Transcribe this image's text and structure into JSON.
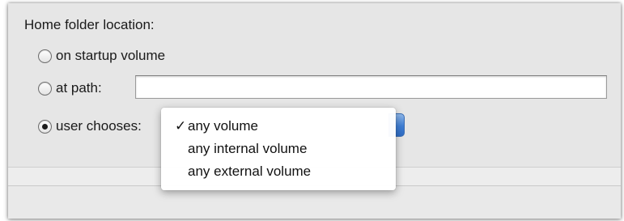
{
  "home_folder": {
    "section_label": "Home folder location:",
    "options": [
      {
        "label": "on startup volume",
        "selected": false
      },
      {
        "label": "at path:",
        "selected": false
      },
      {
        "label": "user chooses:",
        "selected": true
      }
    ],
    "path_value": ""
  },
  "volume_menu": {
    "selected": "any volume",
    "checkmark": "✓",
    "items": [
      {
        "label": "any volume",
        "checked": true
      },
      {
        "label": "any internal volume",
        "checked": false
      },
      {
        "label": "any external volume",
        "checked": false
      }
    ]
  },
  "colors": {
    "panel_background": "#e6e6e6",
    "popup_accent": "#3f7fd6"
  }
}
